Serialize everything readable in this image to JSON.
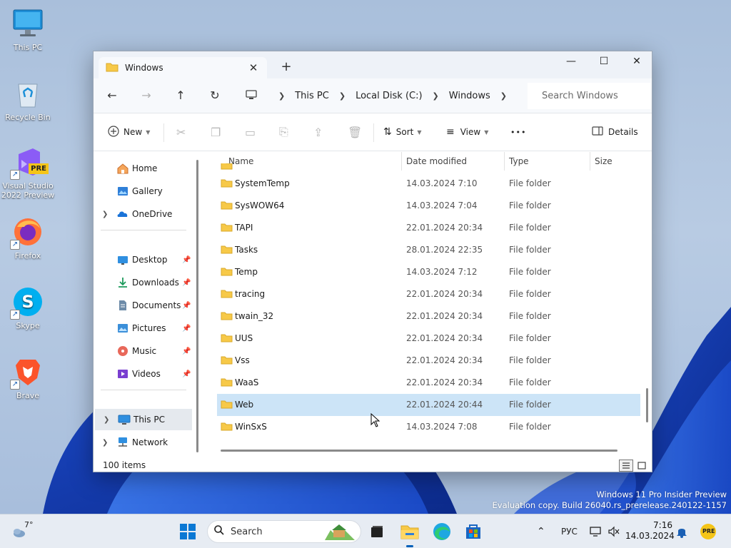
{
  "desktop": {
    "icons": [
      {
        "label": "This PC",
        "icon": "monitor-icon"
      },
      {
        "label": "Recycle Bin",
        "icon": "recycle-bin-icon"
      },
      {
        "label": "Visual Studio 2022 Preview",
        "icon": "visual-studio-icon",
        "badge": "PRE"
      },
      {
        "label": "Firefox",
        "icon": "firefox-icon"
      },
      {
        "label": "Skype",
        "icon": "skype-icon"
      },
      {
        "label": "Brave",
        "icon": "brave-icon"
      }
    ],
    "watermark": {
      "line1": "Windows 11 Pro Insider Preview",
      "line2": "Evaluation copy. Build 26040.rs_prerelease.240122-1157"
    }
  },
  "window": {
    "tab_title": "Windows",
    "tab_close": "✕",
    "new_tab": "+",
    "controls": {
      "minimize": "—",
      "maximize": "☐",
      "close": "✕"
    },
    "nav": {
      "back": "←",
      "forward": "→",
      "up": "↑",
      "refresh": "↻"
    },
    "breadcrumb": [
      "This PC",
      "Local Disk (C:)",
      "Windows"
    ],
    "search_placeholder": "Search Windows",
    "toolbar": {
      "new_label": "New",
      "sort_label": "Sort",
      "view_label": "View",
      "more_label": "•••",
      "details_label": "Details"
    },
    "navpane": {
      "top": [
        {
          "label": "Home",
          "icon": "home-icon"
        },
        {
          "label": "Gallery",
          "icon": "gallery-icon"
        },
        {
          "label": "OneDrive",
          "icon": "onedrive-icon"
        }
      ],
      "quick_access": [
        {
          "label": "Desktop",
          "icon": "desktop-icon"
        },
        {
          "label": "Downloads",
          "icon": "downloads-icon"
        },
        {
          "label": "Documents",
          "icon": "documents-icon"
        },
        {
          "label": "Pictures",
          "icon": "pictures-icon"
        },
        {
          "label": "Music",
          "icon": "music-icon"
        },
        {
          "label": "Videos",
          "icon": "videos-icon"
        }
      ],
      "bottom": [
        {
          "label": "This PC",
          "icon": "this-pc-icon",
          "selected": true
        },
        {
          "label": "Network",
          "icon": "network-icon"
        }
      ]
    },
    "columns": {
      "name": "Name",
      "date": "Date modified",
      "type": "Type",
      "size": "Size"
    },
    "files": [
      {
        "name": "SystemTemp",
        "date": "14.03.2024 7:10",
        "type": "File folder"
      },
      {
        "name": "SysWOW64",
        "date": "14.03.2024 7:04",
        "type": "File folder"
      },
      {
        "name": "TAPI",
        "date": "22.01.2024 20:34",
        "type": "File folder"
      },
      {
        "name": "Tasks",
        "date": "28.01.2024 22:35",
        "type": "File folder"
      },
      {
        "name": "Temp",
        "date": "14.03.2024 7:12",
        "type": "File folder"
      },
      {
        "name": "tracing",
        "date": "22.01.2024 20:34",
        "type": "File folder"
      },
      {
        "name": "twain_32",
        "date": "22.01.2024 20:34",
        "type": "File folder"
      },
      {
        "name": "UUS",
        "date": "22.01.2024 20:34",
        "type": "File folder"
      },
      {
        "name": "Vss",
        "date": "22.01.2024 20:34",
        "type": "File folder"
      },
      {
        "name": "WaaS",
        "date": "22.01.2024 20:34",
        "type": "File folder"
      },
      {
        "name": "Web",
        "date": "22.01.2024 20:44",
        "type": "File folder",
        "selected": true
      },
      {
        "name": "WinSxS",
        "date": "14.03.2024 7:08",
        "type": "File folder"
      }
    ],
    "status": {
      "item_count": "100 items"
    }
  },
  "taskbar": {
    "weather_temp": "7°",
    "search_label": "Search",
    "language": "РУС",
    "time": "7:16",
    "date": "14.03.2024",
    "tray_badge": "PRE"
  },
  "colors": {
    "accent": "#005fb8",
    "selection": "#cce4f7",
    "folder": "#f7c948"
  }
}
